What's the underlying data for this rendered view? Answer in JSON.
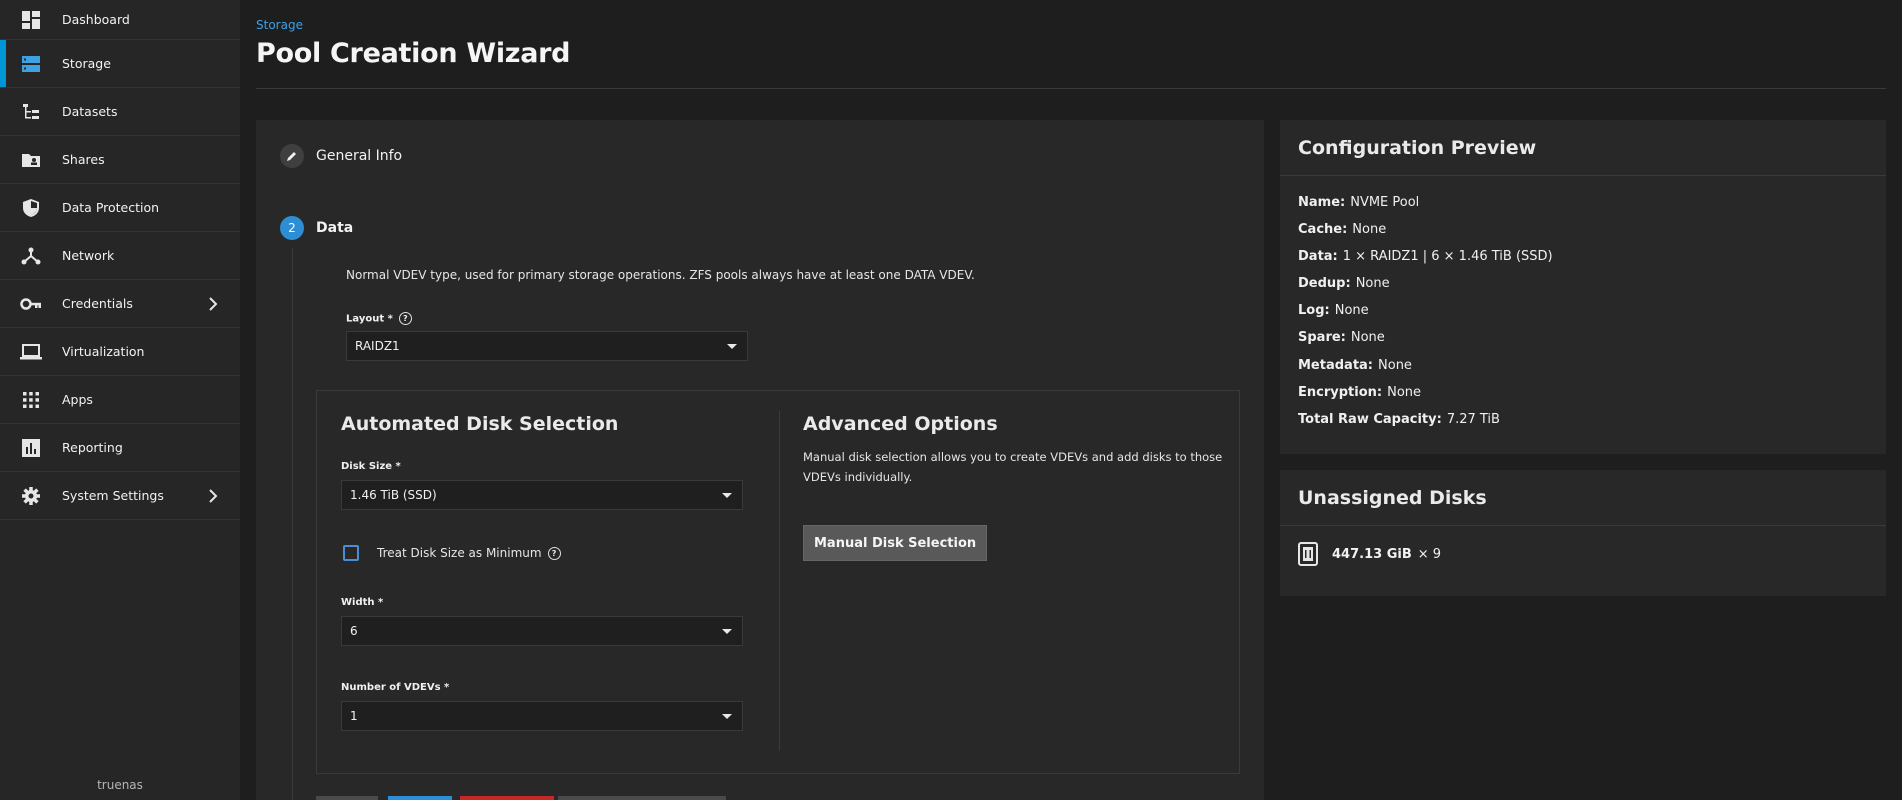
{
  "sidebar": {
    "items": [
      {
        "label": "Dashboard",
        "icon": "dashboard-icon"
      },
      {
        "label": "Storage",
        "icon": "storage-icon"
      },
      {
        "label": "Datasets",
        "icon": "datasets-icon"
      },
      {
        "label": "Shares",
        "icon": "shares-icon"
      },
      {
        "label": "Data Protection",
        "icon": "shield-icon"
      },
      {
        "label": "Network",
        "icon": "network-icon"
      },
      {
        "label": "Credentials",
        "icon": "key-icon"
      },
      {
        "label": "Virtualization",
        "icon": "laptop-icon"
      },
      {
        "label": "Apps",
        "icon": "apps-grid-icon"
      },
      {
        "label": "Reporting",
        "icon": "reporting-icon"
      },
      {
        "label": "System Settings",
        "icon": "gear-icon"
      }
    ],
    "active": "Storage",
    "footer": "truenas"
  },
  "header": {
    "breadcrumb": "Storage",
    "title": "Pool Creation Wizard"
  },
  "wizard": {
    "step1": {
      "title": "General Info"
    },
    "step2": {
      "number": "2",
      "title": "Data",
      "description": "Normal VDEV type, used for primary storage operations. ZFS pools always have at least one DATA VDEV."
    },
    "layout": {
      "label": "Layout *",
      "value": "RAIDZ1"
    },
    "automated": {
      "title": "Automated Disk Selection",
      "disk_size": {
        "label": "Disk Size *",
        "value": "1.46 TiB (SSD)"
      },
      "treat_min": {
        "label": "Treat Disk Size as Minimum"
      },
      "width": {
        "label": "Width *",
        "value": "6"
      },
      "vdevs": {
        "label": "Number of VDEVs *",
        "value": "1"
      }
    },
    "advanced": {
      "title": "Advanced Options",
      "description": "Manual disk selection allows you to create VDEVs and add disks to those VDEVs individually.",
      "button": "Manual Disk Selection"
    }
  },
  "preview": {
    "title": "Configuration Preview",
    "rows": [
      {
        "key": "Name:",
        "value": "NVME Pool"
      },
      {
        "key": "Cache:",
        "value": "None"
      },
      {
        "key": "Data:",
        "value": "1 × RAIDZ1 | 6 × 1.46 TiB (SSD)"
      },
      {
        "key": "Dedup:",
        "value": "None"
      },
      {
        "key": "Log:",
        "value": "None"
      },
      {
        "key": "Spare:",
        "value": "None"
      },
      {
        "key": "Metadata:",
        "value": "None"
      },
      {
        "key": "Encryption:",
        "value": "None"
      },
      {
        "key": "Total Raw Capacity:",
        "value": "7.27 TiB"
      }
    ]
  },
  "unassigned": {
    "title": "Unassigned Disks",
    "size": "447.13 GiB",
    "count": "× 9"
  },
  "colors": {
    "accent": "#0095d5",
    "step_active": "#2d8ed6",
    "bottom_buttons": [
      "#4a4a4a",
      "#2d8ed6",
      "#c62828",
      "#4a4a4a"
    ]
  }
}
